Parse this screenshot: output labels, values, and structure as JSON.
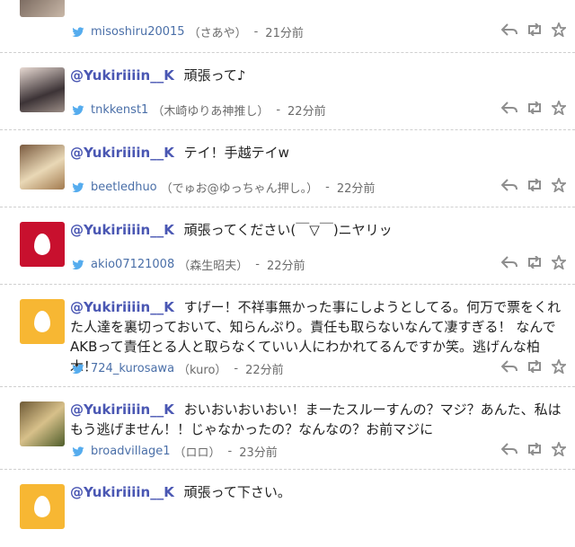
{
  "tweets": [
    {
      "avatar": "photo",
      "handle": "",
      "text": "",
      "user": "misoshiru20015",
      "name": "（さあや）",
      "time": "21分前",
      "sep": "-"
    },
    {
      "avatar": "photo",
      "handle": "@Yukiriiiin__K",
      "text": "頑張って♪",
      "user": "tnkkenst1",
      "name": "（木崎ゆりあ神推し）",
      "time": "22分前",
      "sep": "-"
    },
    {
      "avatar": "photo",
      "handle": "@Yukiriiiin__K",
      "text": "テイ！手越テイw",
      "user": "beetledhuo",
      "name": "（でゅお@ゆっちゃん押し。）",
      "time": "22分前",
      "sep": "-"
    },
    {
      "avatar": "egg-red",
      "handle": "@Yukiriiiin__K",
      "text": "頑張ってください(￣▽￣)ニヤリッ",
      "user": "akio07121008",
      "name": "（森生昭夫）",
      "time": "22分前",
      "sep": "-"
    },
    {
      "avatar": "egg-orange",
      "handle": "@Yukiriiiin__K",
      "text": "すげー！不祥事無かった事にしようとしてる。何万で票をくれた人達を裏切っておいて、知らんぷり。責任も取らないなんて凄すぎる！ なんでAKBって責任とる人と取らなくていい人にわかれてるんですか笑。逃げんな柏木！",
      "user": "724_kurosawa",
      "name": "（kuro）",
      "time": "22分前",
      "sep": "-"
    },
    {
      "avatar": "photo",
      "handle": "@Yukiriiiin__K",
      "text": "おいおいおいおい！まーたスルーすんの？マジ？あんた、私はもう逃げません！！じゃなかったの？なんなの？お前マジに",
      "user": "broadvillage1",
      "name": "（ロロ）",
      "time": "23分前",
      "sep": "-"
    },
    {
      "avatar": "egg-orange",
      "handle": "@Yukiriiiin__K",
      "text": "頑張って下さい。",
      "user": "",
      "name": "",
      "time": "",
      "sep": ""
    }
  ],
  "colors": {
    "handle": "#4a57b3",
    "bird": "#55acee",
    "egg_orange": "#f7b733",
    "egg_red": "#c8102e"
  },
  "icons": [
    "twitter-bird-icon",
    "reply-icon",
    "retweet-icon",
    "favorite-icon"
  ]
}
